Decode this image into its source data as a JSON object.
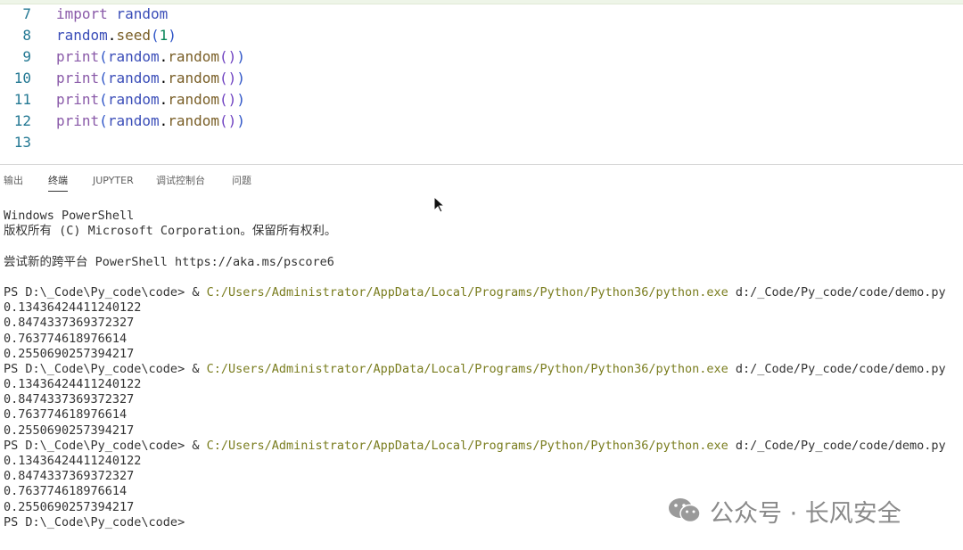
{
  "editor": {
    "lines": [
      {
        "num": "7",
        "parts": [
          {
            "t": "import",
            "c": "kw"
          },
          {
            "t": " random",
            "c": "mod"
          }
        ]
      },
      {
        "num": "8",
        "parts": [
          {
            "t": "random",
            "c": "mod"
          },
          {
            "t": ".",
            "c": ""
          },
          {
            "t": "seed",
            "c": "fn"
          },
          {
            "t": "(",
            "c": "paren1"
          },
          {
            "t": "1",
            "c": "num"
          },
          {
            "t": ")",
            "c": "paren1"
          }
        ]
      },
      {
        "num": "9",
        "parts": [
          {
            "t": "print",
            "c": "kw"
          },
          {
            "t": "(",
            "c": "paren1"
          },
          {
            "t": "random",
            "c": "mod"
          },
          {
            "t": ".",
            "c": ""
          },
          {
            "t": "random",
            "c": "fn"
          },
          {
            "t": "()",
            "c": "paren2"
          },
          {
            "t": ")",
            "c": "paren1"
          }
        ]
      },
      {
        "num": "10",
        "parts": [
          {
            "t": "print",
            "c": "kw"
          },
          {
            "t": "(",
            "c": "paren1"
          },
          {
            "t": "random",
            "c": "mod"
          },
          {
            "t": ".",
            "c": ""
          },
          {
            "t": "random",
            "c": "fn"
          },
          {
            "t": "()",
            "c": "paren2"
          },
          {
            "t": ")",
            "c": "paren1"
          }
        ]
      },
      {
        "num": "11",
        "parts": [
          {
            "t": "print",
            "c": "kw"
          },
          {
            "t": "(",
            "c": "paren1"
          },
          {
            "t": "random",
            "c": "mod"
          },
          {
            "t": ".",
            "c": ""
          },
          {
            "t": "random",
            "c": "fn"
          },
          {
            "t": "()",
            "c": "paren2"
          },
          {
            "t": ")",
            "c": "paren1"
          }
        ]
      },
      {
        "num": "12",
        "parts": [
          {
            "t": "print",
            "c": "kw"
          },
          {
            "t": "(",
            "c": "paren1"
          },
          {
            "t": "random",
            "c": "mod"
          },
          {
            "t": ".",
            "c": ""
          },
          {
            "t": "random",
            "c": "fn"
          },
          {
            "t": "()",
            "c": "paren2"
          },
          {
            "t": ")",
            "c": "paren1"
          }
        ]
      },
      {
        "num": "13",
        "parts": []
      }
    ]
  },
  "panel_tabs": [
    {
      "label": "输出",
      "active": false
    },
    {
      "label": "终端",
      "active": true
    },
    {
      "label": "JUPYTER",
      "active": false
    },
    {
      "label": "调试控制台",
      "active": false
    },
    {
      "label": "问题",
      "active": false
    }
  ],
  "terminal": {
    "lines": [
      {
        "text": "Windows PowerShell"
      },
      {
        "text": "版权所有 (C) Microsoft Corporation。保留所有权利。"
      },
      {
        "text": ""
      },
      {
        "text": "尝试新的跨平台 PowerShell https://aka.ms/pscore6"
      },
      {
        "text": ""
      },
      {
        "prompt": "PS D:\\_Code\\Py_code\\code> & ",
        "path": "C:/Users/Administrator/AppData/Local/Programs/Python/Python36/python.exe",
        "arg": " d:/_Code/Py_code/code/demo.py"
      },
      {
        "text": "0.13436424411240122"
      },
      {
        "text": "0.8474337369372327"
      },
      {
        "text": "0.763774618976614"
      },
      {
        "text": "0.2550690257394217"
      },
      {
        "prompt": "PS D:\\_Code\\Py_code\\code> & ",
        "path": "C:/Users/Administrator/AppData/Local/Programs/Python/Python36/python.exe",
        "arg": " d:/_Code/Py_code/code/demo.py"
      },
      {
        "text": "0.13436424411240122"
      },
      {
        "text": "0.8474337369372327"
      },
      {
        "text": "0.763774618976614"
      },
      {
        "text": "0.2550690257394217"
      },
      {
        "prompt": "PS D:\\_Code\\Py_code\\code> & ",
        "path": "C:/Users/Administrator/AppData/Local/Programs/Python/Python36/python.exe",
        "arg": " d:/_Code/Py_code/code/demo.py"
      },
      {
        "text": "0.13436424411240122"
      },
      {
        "text": "0.8474337369372327"
      },
      {
        "text": "0.763774618976614"
      },
      {
        "text": "0.2550690257394217"
      },
      {
        "text": "PS D:\\_Code\\Py_code\\code>"
      }
    ]
  },
  "watermark": {
    "text": "公众号 · 长风安全",
    "icon": "wechat-icon"
  }
}
